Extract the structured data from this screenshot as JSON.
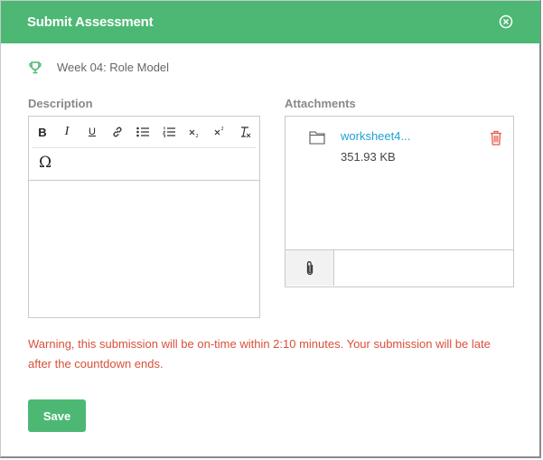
{
  "header": {
    "title": "Submit Assessment"
  },
  "week": {
    "label": "Week 04: Role Model",
    "icon": "trophy-icon"
  },
  "description": {
    "label": "Description"
  },
  "editor": {
    "toolbar": {
      "bold": "B",
      "italic": "I",
      "underline": "U",
      "special_char": "Ω"
    },
    "content": ""
  },
  "attachments": {
    "label": "Attachments",
    "files": [
      {
        "name": "worksheet4...",
        "size": "351.93 KB"
      }
    ]
  },
  "warning": "Warning, this submission will be on-time within 2:10 minutes. Your submission will be late after the countdown ends.",
  "actions": {
    "save_label": "Save"
  },
  "colors": {
    "accent": "#4cb874",
    "warning": "#d9503a",
    "link": "#1fa2d3",
    "danger": "#e8574a"
  }
}
